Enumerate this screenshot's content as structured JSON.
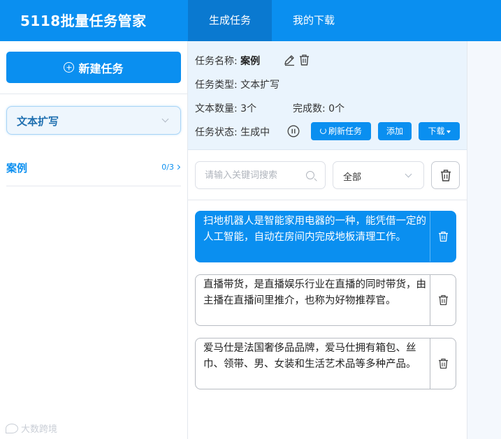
{
  "app": {
    "title": "5118批量任务管家"
  },
  "nav": {
    "tabs": [
      {
        "label": "生成任务",
        "active": true
      },
      {
        "label": "我的下载",
        "active": false
      }
    ]
  },
  "sidebar": {
    "new_task_label": "新建任务",
    "type_select_value": "文本扩写",
    "tasks": [
      {
        "name": "案例",
        "progress": "0/3"
      }
    ],
    "watermark": "大数跨境"
  },
  "task_info": {
    "name_label": "任务名称:",
    "name_value": "案例",
    "type_label": "任务类型:",
    "type_value": "文本扩写",
    "count_label": "文本数量:",
    "count_value": "3个",
    "completed_label": "完成数:",
    "completed_value": "0个",
    "status_label": "任务状态:",
    "status_value": "生成中",
    "refresh_label": "刷新任务",
    "add_label": "添加",
    "download_label": "下载"
  },
  "filter": {
    "search_placeholder": "请输入关键词搜索",
    "status_value": "全部"
  },
  "texts": [
    {
      "content": "扫地机器人是智能家用电器的一种，能凭借一定的人工智能，自动在房间内完成地板清理工作。",
      "selected": true
    },
    {
      "content": "直播带货，是直播娱乐行业在直播的同时带货，由主播在直播间里推介，也称为好物推荐官。",
      "selected": false
    },
    {
      "content": "爱马仕是法国奢侈品品牌，爱马仕拥有箱包、丝巾、领带、男、女装和生活艺术品等多种产品。",
      "selected": false
    }
  ],
  "colors": {
    "primary": "#0a8ff0",
    "header_active_tab": "#0a79d0",
    "info_panel_bg": "#eaf4fd"
  },
  "icons": [
    "plus-circle-icon",
    "chevron-down-icon",
    "chevron-right-icon",
    "edit-icon",
    "trash-icon",
    "pause-icon",
    "refresh-icon",
    "caret-down-icon",
    "search-icon"
  ]
}
